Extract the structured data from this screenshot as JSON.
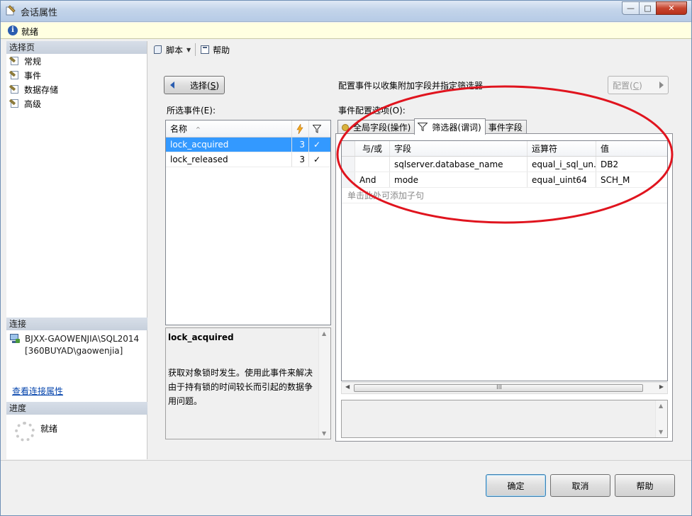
{
  "window": {
    "title": "会话属性",
    "min_glyph": "—",
    "max_glyph": "□",
    "close_glyph": "✕"
  },
  "status": {
    "info_glyph": "i",
    "text": "就绪"
  },
  "sidebar": {
    "select_page_header": "选择页",
    "items": [
      {
        "label": "常规"
      },
      {
        "label": "事件"
      },
      {
        "label": "数据存储"
      },
      {
        "label": "高级"
      }
    ],
    "connection_header": "连接",
    "connection_text": "BJXX-GAOWENJIA\\SQL2014 [360BUYAD\\gaowenjia]",
    "view_connection_link": "查看连接属性",
    "progress_header": "进度",
    "progress_text": "就绪"
  },
  "toolbar": {
    "script_label": "脚本",
    "help_label": "帮助"
  },
  "select_button": {
    "label": "选择(",
    "mnemonic": "S",
    "suffix": ")"
  },
  "config_caption": "配置事件以收集附加字段并指定筛选器",
  "config_button": {
    "label": "配置(",
    "mnemonic": "C",
    "suffix": ")"
  },
  "selected_events_label": "所选事件(E):",
  "event_config_label": "事件配置选项(O):",
  "events_grid": {
    "col_name": "名称",
    "sort_glyph": "^",
    "rows": [
      {
        "name": "lock_acquired",
        "count": "3",
        "check": "✓",
        "selected": true
      },
      {
        "name": "lock_released",
        "count": "3",
        "check": "✓",
        "selected": false
      }
    ]
  },
  "description": {
    "title": "lock_acquired",
    "body": "获取对象锁时发生。使用此事件来解决由于持有锁的时间较长而引起的数据争用问题。"
  },
  "tabs": [
    {
      "label": "全局字段(操作)",
      "active": false
    },
    {
      "label": "筛选器(谓词)",
      "active": true
    },
    {
      "label": "事件字段",
      "active": false
    }
  ],
  "filter_grid": {
    "headers": {
      "andor": "与/或",
      "field": "字段",
      "operator": "运算符",
      "value": "值"
    },
    "rows": [
      {
        "andor": "",
        "field": "sqlserver.database_name",
        "operator": "equal_i_sql_un...",
        "value": "DB2"
      },
      {
        "andor": "And",
        "field": "mode",
        "operator": "equal_uint64",
        "value": "SCH_M"
      }
    ],
    "hint": "单击此处可添加子句",
    "grip_glyph": "III"
  },
  "buttons": {
    "ok": "确定",
    "cancel": "取消",
    "help": "帮助"
  },
  "colors": {
    "selection": "#3399ff",
    "annotation_ellipse": "#e0141e",
    "link": "#0645ad"
  }
}
